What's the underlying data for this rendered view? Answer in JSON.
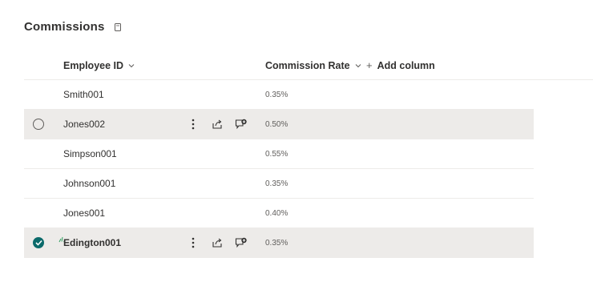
{
  "page": {
    "title": "Commissions",
    "view_icon": "document-view-icon"
  },
  "columns": {
    "employee_id": "Employee ID",
    "commission_rate": "Commission Rate",
    "add_column": "Add column"
  },
  "rows": [
    {
      "employee_id": "Smith001",
      "commission_rate": "0.35%",
      "state": "normal"
    },
    {
      "employee_id": "Jones002",
      "commission_rate": "0.50%",
      "state": "hovered"
    },
    {
      "employee_id": "Simpson001",
      "commission_rate": "0.55%",
      "state": "normal"
    },
    {
      "employee_id": "Johnson001",
      "commission_rate": "0.35%",
      "state": "normal"
    },
    {
      "employee_id": "Jones001",
      "commission_rate": "0.40%",
      "state": "normal"
    },
    {
      "employee_id": "Edington001",
      "commission_rate": "0.35%",
      "state": "selected"
    }
  ],
  "row_action_icons": [
    "more-vertical-icon",
    "share-icon",
    "comment-add-icon"
  ],
  "colors": {
    "accent": "#0b6a6a",
    "row_highlight": "#edebe9",
    "text_primary": "#323130",
    "text_secondary": "#605e5c",
    "new_item_mark": "#2e9e5e"
  }
}
